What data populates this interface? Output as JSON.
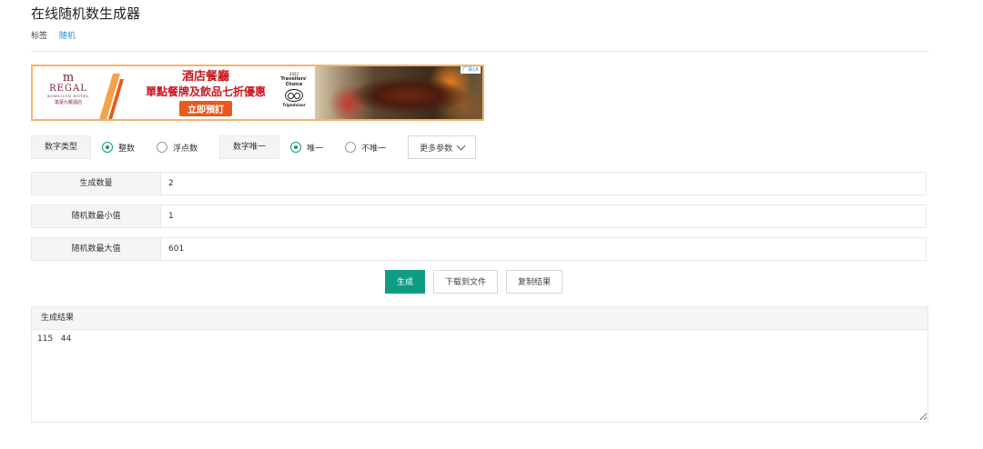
{
  "page": {
    "title": "在线随机数生成器",
    "tags_label": "标签",
    "tag_link": "随机"
  },
  "ad": {
    "logo_mark": "m",
    "logo_brand": "REGAL",
    "logo_sub": "KOWLOON HOTEL",
    "logo_cn": "富豪九龍酒店",
    "line1": "酒店餐廳",
    "line2": "單點餐牌及飲品七折優惠",
    "cta": "立即預訂",
    "award_year": "2022",
    "award_line1": "Travellers'",
    "award_line2": "Choice",
    "award_brand": "Tripadvisor",
    "badge": "广告|X"
  },
  "options": {
    "number_type_label": "数字类型",
    "integer_label": "整数",
    "float_label": "浮点数",
    "unique_label": "数字唯一",
    "unique_yes_label": "唯一",
    "unique_no_label": "不唯一",
    "more_label": "更多参数"
  },
  "form": {
    "count_label": "生成数量",
    "count_value": "2",
    "min_label": "随机数最小值",
    "min_value": "1",
    "max_label": "随机数最大值",
    "max_value": "601"
  },
  "actions": {
    "generate": "生成",
    "download": "下载到文件",
    "copy": "复制结果"
  },
  "result": {
    "header": "生成结果",
    "value": "115   44"
  }
}
